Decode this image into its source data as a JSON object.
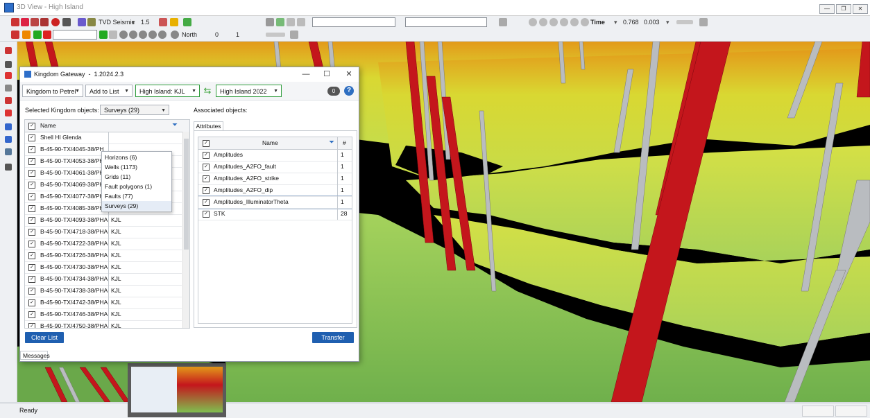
{
  "window": {
    "title": "3D View - High Island",
    "controls": [
      "—",
      "❐",
      "✕"
    ]
  },
  "toolbar1": {
    "view_mode": "TVD Seismic",
    "exaggeration": "1.5",
    "domain": "Time",
    "value1": "0.768",
    "value2": "0.003"
  },
  "toolbar2": {
    "direction": "North",
    "value_a": "0",
    "value_b": "1"
  },
  "status": {
    "text": "Ready"
  },
  "dialog": {
    "title": "Kingdom Gateway",
    "version": "1.2024.2.3",
    "controls": {
      "min": "—",
      "max": "☐",
      "close": "✕"
    },
    "direction_dropdown": "Kingdom to  Petrel",
    "action_dropdown": "Add to List",
    "source_project": "High Island: KJL",
    "target_project": "High Island 2022",
    "badge_count": "0",
    "help": "?",
    "selected_label": "Selected Kingdom objects:",
    "object_type_selected": "Surveys (29)",
    "object_type_options": [
      "Horizons (6)",
      "Wells (1173)",
      "Grids (11)",
      "Fault polygons (1)",
      "Faults (77)",
      "Surveys (29)"
    ],
    "left_table": {
      "column_name": "Name",
      "rows": [
        {
          "name": "Shell HI Glenda",
          "owner": ""
        },
        {
          "name": "B-45-90-TX/4045-38/PH",
          "owner": ""
        },
        {
          "name": "B-45-90-TX/4053-38/PH",
          "owner": ""
        },
        {
          "name": "B-45-90-TX/4061-38/PH",
          "owner": ""
        },
        {
          "name": "B-45-90-TX/4069-38/PHASI",
          "owner": "KJL"
        },
        {
          "name": "B-45-90-TX/4077-38/PHASI",
          "owner": "KJL"
        },
        {
          "name": "B-45-90-TX/4085-38/PHASI",
          "owner": "KJL"
        },
        {
          "name": "B-45-90-TX/4093-38/PHASI",
          "owner": "KJL"
        },
        {
          "name": "B-45-90-TX/4718-38/PHASI",
          "owner": "KJL"
        },
        {
          "name": "B-45-90-TX/4722-38/PHASI",
          "owner": "KJL"
        },
        {
          "name": "B-45-90-TX/4726-38/PHASI",
          "owner": "KJL"
        },
        {
          "name": "B-45-90-TX/4730-38/PHASI",
          "owner": "KJL"
        },
        {
          "name": "B-45-90-TX/4734-38/PHASI",
          "owner": "KJL"
        },
        {
          "name": "B-45-90-TX/4738-38/PHASI",
          "owner": "KJL"
        },
        {
          "name": "B-45-90-TX/4742-38/PHASI",
          "owner": "KJL"
        },
        {
          "name": "B-45-90-TX/4746-38/PHASI",
          "owner": "KJL"
        },
        {
          "name": "B-45-90-TX/4750-38/PHASI",
          "owner": "KJL"
        }
      ]
    },
    "associated_label": "Associated objects:",
    "attributes_tab": "Attributes",
    "right_table": {
      "column_name": "Name",
      "column_count": "#",
      "rows": [
        {
          "name": "Amplitudes",
          "count": "1"
        },
        {
          "name": "Amplitudes_A2FO_fault",
          "count": "1"
        },
        {
          "name": "Amplitudes_A2FO_strike",
          "count": "1"
        },
        {
          "name": "Amplitudes_A2FO_dip",
          "count": "1"
        },
        {
          "name": "Amplitudes_IlluminatorTheta",
          "count": "1"
        },
        {
          "name": "STK",
          "count": "28"
        }
      ]
    },
    "clear_button": "Clear List",
    "transfer_button": "Transfer",
    "messages_tab": "Messages"
  },
  "colors": {
    "accent_blue": "#1f5fb0",
    "project_border_green": "#2e9c3b",
    "well_red": "#c4161c",
    "surface_yellow": "#d6e03a",
    "surface_green": "#8ec35a"
  }
}
